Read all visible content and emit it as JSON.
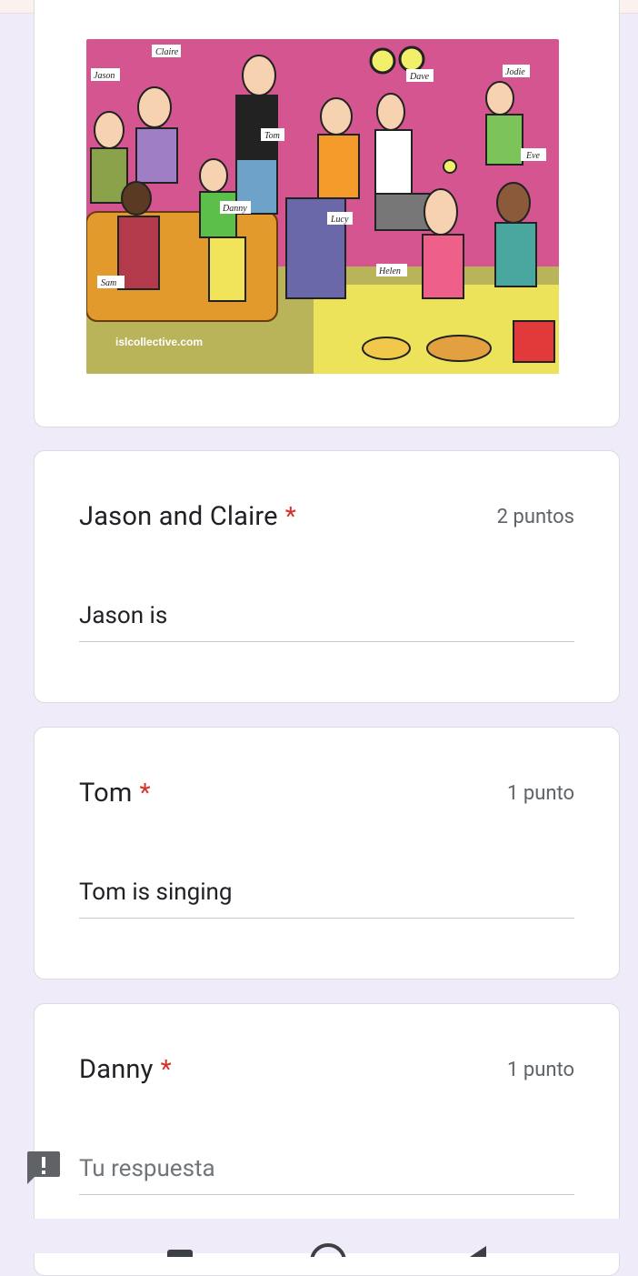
{
  "image": {
    "labels": [
      "Claire",
      "Jason",
      "Tom",
      "Dave",
      "Jodie",
      "Eve",
      "Danny",
      "Lucy",
      "Sam",
      "Helen"
    ],
    "watermark": "islcollective.com"
  },
  "questions": [
    {
      "title": "Jason and Claire",
      "required_mark": "*",
      "points": "2 puntos",
      "answer": "Jason is"
    },
    {
      "title": "Tom",
      "required_mark": "*",
      "points": "1 punto",
      "answer": "Tom is singing"
    },
    {
      "title": "Danny",
      "required_mark": "*",
      "points": "1 punto",
      "placeholder": "Tu respuesta"
    }
  ],
  "colors": {
    "background": "#f0ebf8",
    "required": "#d93025",
    "feedback": "#5f6368"
  },
  "icons": {
    "feedback": "report-icon",
    "nav": [
      "recent-apps-icon",
      "home-icon",
      "back-icon"
    ]
  }
}
